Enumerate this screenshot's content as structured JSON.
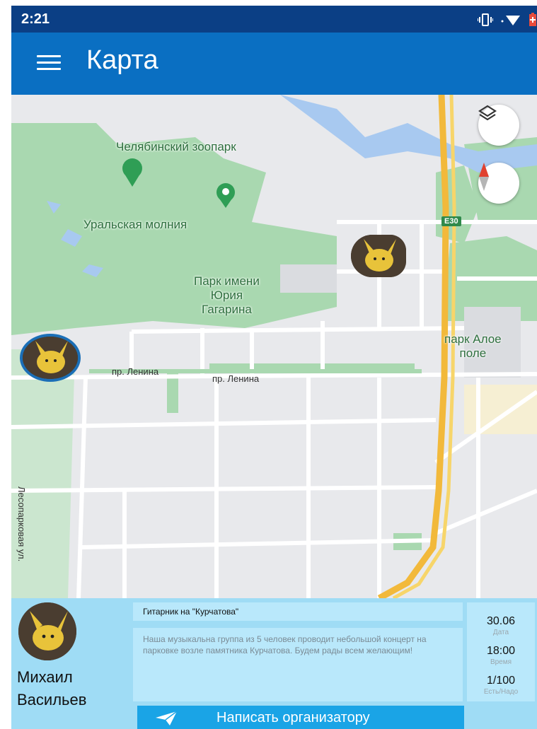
{
  "status_bar": {
    "time": "2:21"
  },
  "app_bar": {
    "title": "Карта"
  },
  "map": {
    "labels": {
      "zoo": "Челябинский зоопарк",
      "ural_lightning": "Уральская молния",
      "park_gagarin": [
        "Парк имени",
        "Юрия",
        "Гагарина"
      ],
      "park_aloe": [
        "парк Алое",
        "поле"
      ],
      "highway_badge": "E30"
    },
    "streets": {
      "lenina_1": "пр. Ленина",
      "lenina_2": "пр. Ленина",
      "lesoparkovaya": "Лесопарковая ул."
    }
  },
  "event_card": {
    "organizer_first": "Михаил",
    "organizer_last": "Васильев",
    "title": "Гитарник на \"Курчатова\"",
    "description": "Наша музыкальна группа из 5 человек проводит небольшой концерт на парковке возле памятника Курчатова. Будем рады всем желающим!",
    "date_value": "30.06",
    "date_caption": "Дата",
    "time_value": "18:00",
    "time_caption": "Время",
    "participants_value": "1/100",
    "participants_caption": "Есть/Надо",
    "contact_button": "Написать организатору"
  },
  "colors": {
    "status_bar": "#0b3f85",
    "app_bar": "#0a6fc2",
    "sheet": "#9fdcf5",
    "button": "#1aa4e6"
  }
}
